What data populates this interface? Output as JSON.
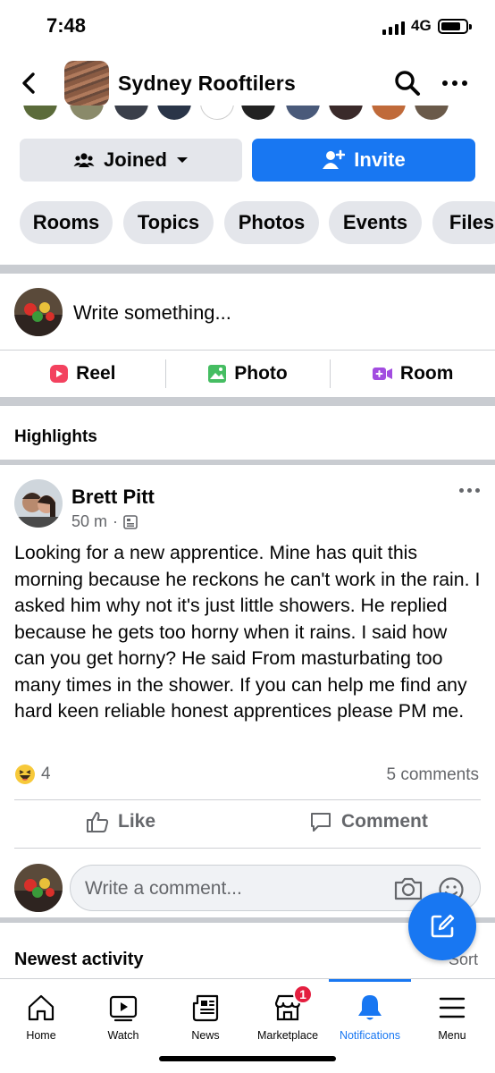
{
  "status_bar": {
    "time": "7:48",
    "network": "4G"
  },
  "header": {
    "title": "Sydney Rooftilers"
  },
  "group_actions": {
    "joined_label": "Joined",
    "invite_label": "Invite"
  },
  "tabs": [
    "Rooms",
    "Topics",
    "Photos",
    "Events",
    "Files"
  ],
  "composer": {
    "placeholder": "Write something...",
    "reel_label": "Reel",
    "photo_label": "Photo",
    "room_label": "Room"
  },
  "section_highlights": "Highlights",
  "post": {
    "author": "Brett Pitt",
    "time": "50 m",
    "body": "Looking for a new apprentice. Mine has quit this morning because he reckons he can't work in the rain. I asked him why not it's just  little showers. He replied because he gets too horny when it rains. I said how can you get horny? He said From masturbating too many times in the shower. If you can help me find any hard keen reliable honest apprentices please PM me.",
    "reaction_count": "4",
    "comment_count": "5 comments",
    "like_label": "Like",
    "comment_label": "Comment",
    "comment_placeholder": "Write a comment..."
  },
  "newest_activity": {
    "title": "Newest activity",
    "sort_label": "Sort"
  },
  "bottom_nav": [
    {
      "label": "Home",
      "icon": "home-icon"
    },
    {
      "label": "Watch",
      "icon": "video-icon"
    },
    {
      "label": "News",
      "icon": "newspaper-icon"
    },
    {
      "label": "Marketplace",
      "icon": "storefront-icon",
      "badge": "1"
    },
    {
      "label": "Notifications",
      "icon": "bell-icon",
      "active": true
    },
    {
      "label": "Menu",
      "icon": "hamburger-icon"
    }
  ],
  "colors": {
    "accent": "#1877f2",
    "badge": "#e41e3f",
    "chip_bg": "#e4e6eb",
    "muted_text": "#65676b"
  }
}
